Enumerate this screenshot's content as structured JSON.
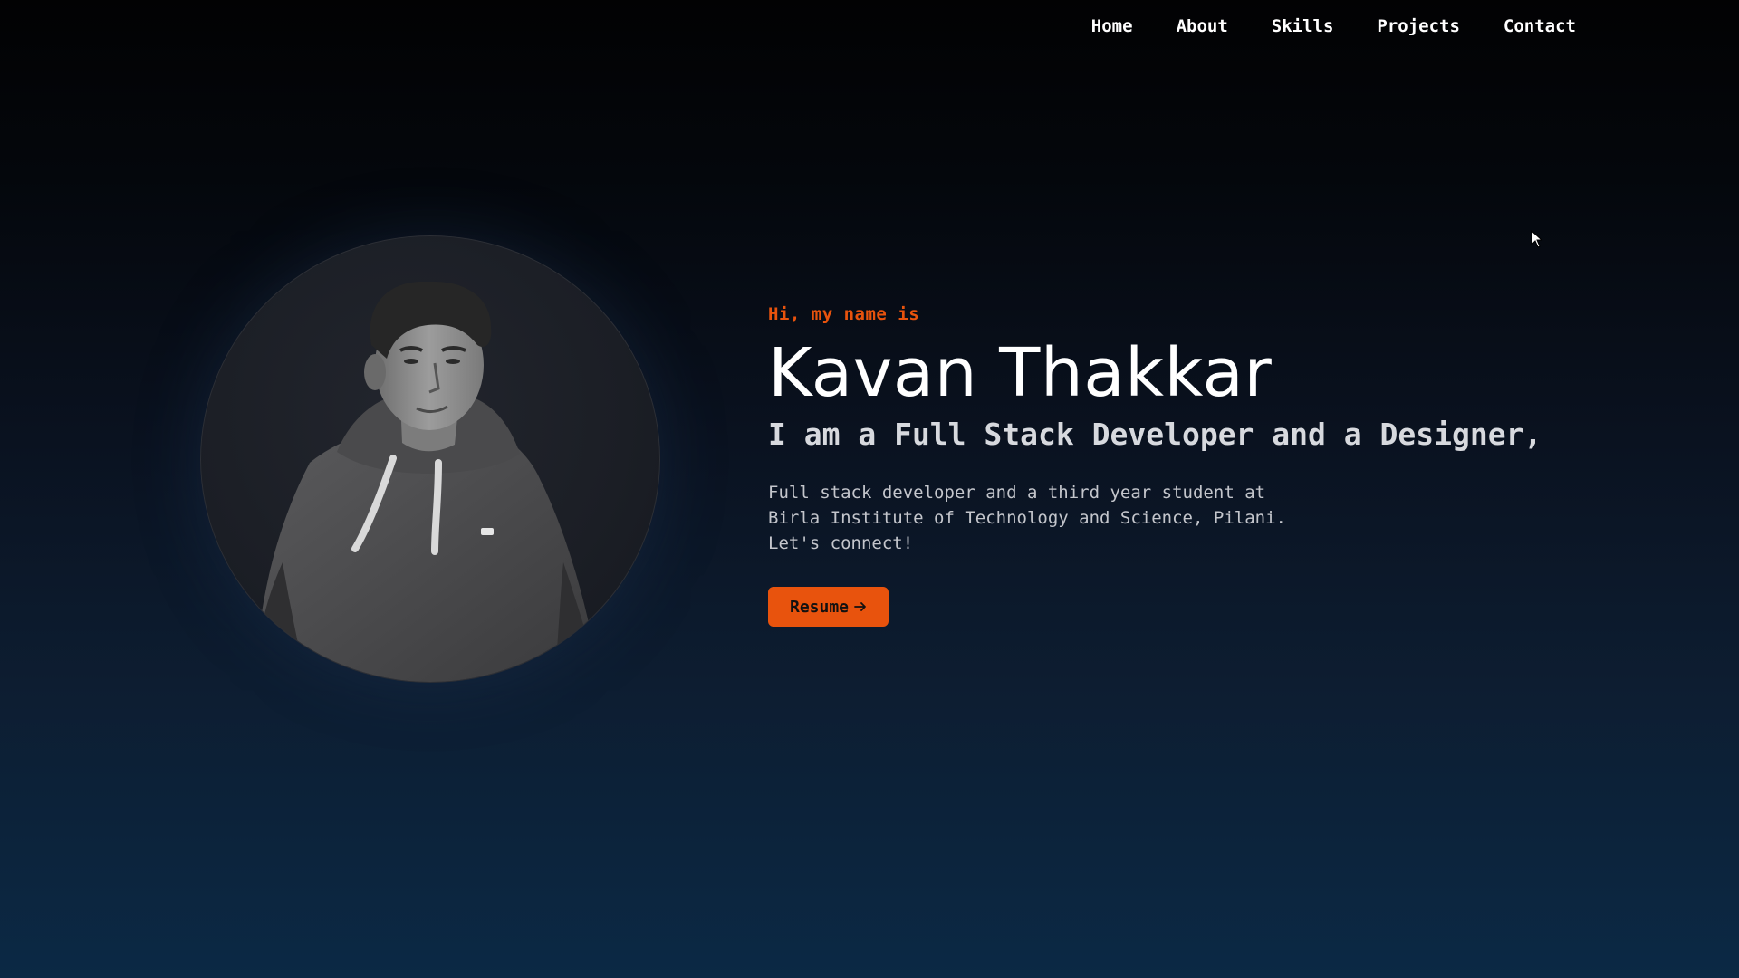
{
  "nav": {
    "items": [
      {
        "label": "Home"
      },
      {
        "label": "About"
      },
      {
        "label": "Skills"
      },
      {
        "label": "Projects"
      },
      {
        "label": "Contact"
      }
    ]
  },
  "hero": {
    "greeting": "Hi, my name is",
    "name": "Kavan Thakkar",
    "tagline": "I am a Full Stack Developer and a Designer,",
    "bio_lines": [
      "Full stack developer and a third year student at",
      "Birla Institute of Technology and Science, Pilani.",
      "Let's connect!"
    ],
    "resume_label": "Resume",
    "resume_icon": "arrow-right-icon"
  },
  "colors": {
    "accent": "#e8530d",
    "text": "#ffffff",
    "muted_text": "#c4c6cc"
  }
}
